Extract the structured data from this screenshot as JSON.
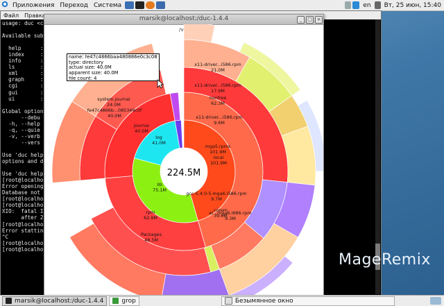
{
  "top_panel": {
    "apps_label": "Приложения",
    "places_label": "Переход",
    "system_label": "Система",
    "keyboard_layout": "en",
    "clock": "Вт, 25 июн, 15:40"
  },
  "terminal": {
    "menu": [
      "Файл",
      "Правка"
    ],
    "lines": [
      "usage: duc <c",
      "",
      "Available sub",
      "",
      "  help      :",
      "  index     :",
      "  info      :",
      "  ls        :",
      "  xml       :",
      "  graph     :",
      "  cgi       :",
      "  gui       :",
      "  ui        :",
      "",
      "Global option",
      "      --debu",
      "  -h, --help",
      "  -q, --quie",
      "  -v, --verb",
      "      --vers",
      "",
      "Use 'duc help",
      "options and d",
      "",
      "Use 'duc help",
      "[root@localho",
      "Error opening",
      "Database not ",
      "[root@localho",
      "[root@localho",
      "XIO:  fatal I",
      "      after 2",
      "[root@localho",
      "Error statting",
      "^C",
      "[root@localho",
      "[root@localho",
      ""
    ]
  },
  "duc_window": {
    "title": "marsik@localhost:/duc-1.4.4",
    "path": "/var",
    "total": "224.5M"
  },
  "tooltip": {
    "name": "name: fe47c4866baa480886e0c3c085349c0f",
    "type": "type: directory",
    "actual": "actual size: 40.0M",
    "apparent": "apparent size: 40.0M",
    "count": "file count: 4"
  },
  "labels": [
    {
      "text": "x11-driver...i586.rpm",
      "size": "21.0M"
    },
    {
      "text": "x11-driver...i586.rpm",
      "size": "17.9M"
    },
    {
      "text": "nonfree",
      "size": "62.3M"
    },
    {
      "text": "x11-driver...i586.rpm",
      "size": "9.6M"
    },
    {
      "text": "mga5.rpms",
      "size": "101.9M"
    },
    {
      "text": "local",
      "size": "101.9M"
    },
    {
      "text": "gcc-5.4.0-5.mga6.i586.rpm",
      "size": "9.7M"
    },
    {
      "text": "corem",
      "size": "39.6M"
    },
    {
      "text": "el...mga6.i686.rpm",
      "size": "9.3M"
    },
    {
      "text": "system.journal",
      "size": "24.0M"
    },
    {
      "text": "fe47c4866b...085349c0f",
      "size": "40.0M"
    },
    {
      "text": "journal",
      "size": "40.0M"
    },
    {
      "text": "log",
      "size": "41.0M"
    },
    {
      "text": "lib",
      "size": "75.1M"
    },
    {
      "text": "rpm",
      "size": "62.9M"
    },
    {
      "text": "Packages",
      "size": "48.5M"
    }
  ],
  "logo_text": "MageRemix",
  "taskbar": {
    "tasks": [
      "marsik@localhost:/duc-1.4.4",
      "grop",
      "Безымянное окно"
    ]
  },
  "colors": {
    "desktop": "#3f78a8",
    "local_red": "#ff4a1c",
    "lib_green": "#8cf012",
    "log_cyan": "#1ee6f0",
    "ring_red": "#ff3a3a",
    "peach": "#ffb090",
    "yellow_green": "#e2f070",
    "purple": "#a070f0"
  }
}
